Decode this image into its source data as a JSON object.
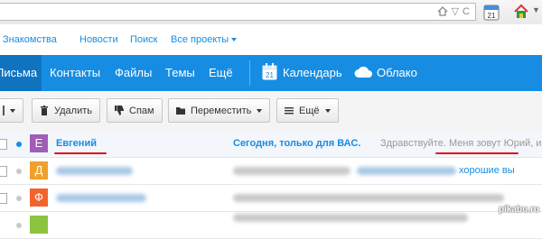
{
  "colors": {
    "accent": "#168de2",
    "nav_active": "#0f73c0",
    "underline": "#e0151b"
  },
  "top_links": {
    "dating": "Знакомства",
    "news": "Новости",
    "search": "Поиск",
    "all_projects": "Все проекты"
  },
  "nav": {
    "mail": "Письма",
    "contacts": "Контакты",
    "files": "Файлы",
    "themes": "Темы",
    "more": "Ещё",
    "calendar": "Календарь",
    "cloud": "Облако"
  },
  "toolbar": {
    "delete": "Удалить",
    "spam": "Спам",
    "move": "Переместить",
    "more": "Ещё"
  },
  "calendar_icon_day": "21",
  "messages": [
    {
      "avatar_letter": "Е",
      "avatar_color": "#a05db7",
      "sender": "Евгений",
      "subject": "Сегодня, только для ВАС.",
      "snippet": "Здравствуйте. Меня зовут Юрий, и я",
      "unread": true
    },
    {
      "avatar_letter": "Д",
      "avatar_color": "#f0a02a",
      "snippet_tail": "хорошие вы",
      "unread": false
    },
    {
      "avatar_letter": "Ф",
      "avatar_color": "#f2642c",
      "unread": false
    },
    {
      "avatar_letter": "",
      "avatar_color": "#8cc43f",
      "unread": false
    }
  ],
  "watermark": "pikabu.ru"
}
